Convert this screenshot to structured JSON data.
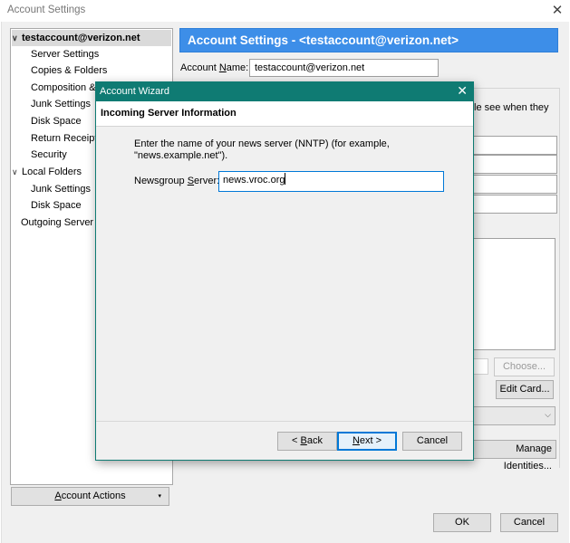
{
  "window": {
    "title": "Account Settings",
    "close": "✕"
  },
  "tree": {
    "account": "testaccount@verizon.net",
    "account_items": [
      "Server Settings",
      "Copies & Folders",
      "Composition &",
      "Junk Settings",
      "Disk Space",
      "Return Receipts",
      "Security"
    ],
    "local": "Local Folders",
    "local_items": [
      "Junk Settings",
      "Disk Space"
    ],
    "outgoing": "Outgoing Server (",
    "expand_glyph": "∨"
  },
  "account_actions": {
    "label": "Account Actions",
    "arrow": "▾"
  },
  "panel": {
    "header": "Account Settings - <testaccount@verizon.net>",
    "account_name_label": "Account Name:",
    "account_name_value": "testaccount@verizon.net",
    "behind_text": "le see when they",
    "choose_label": "Choose...",
    "edit_card_label": "Edit Card...",
    "select_arrow": "⌵",
    "manage_label": "Manage Identities..."
  },
  "footer": {
    "ok": "OK",
    "cancel": "Cancel"
  },
  "wizard": {
    "title": "Account Wizard",
    "close": "✕",
    "heading": "Incoming Server Information",
    "description": "Enter the name of your news server (NNTP) (for example, \"news.example.net\").",
    "newsgroup_label": "Newsgroup Server:",
    "newsgroup_value": "news.vroc.org",
    "back": "< Back",
    "next": "Next >",
    "cancel": "Cancel"
  },
  "colors": {
    "header_blue": "#3d8ee8",
    "wizard_teal": "#0f7b73",
    "focus_blue": "#0078d7"
  }
}
